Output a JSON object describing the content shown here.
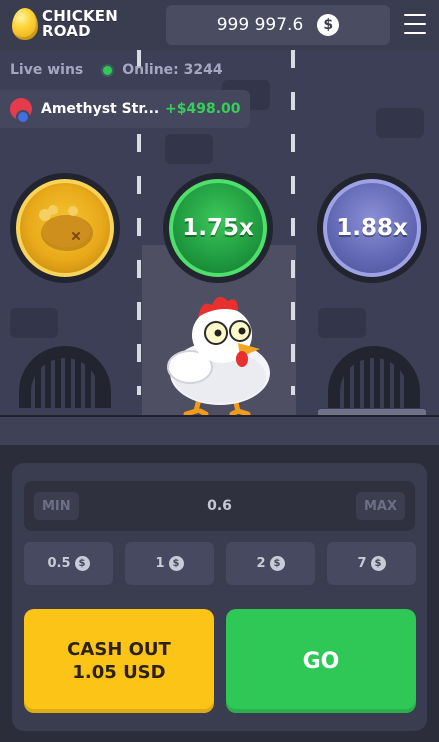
{
  "header": {
    "logo_line1": "CHICKEN",
    "logo_line2": "ROAD",
    "balance": "999 997.6",
    "currency_symbol": "$"
  },
  "live": {
    "label": "Live wins",
    "online": "Online: 3244"
  },
  "last_win": {
    "player": "Amethyst Str...",
    "amount": "+$498.00"
  },
  "lanes": {
    "multipliers": [
      "1.75x",
      "1.88x"
    ]
  },
  "controls": {
    "min_label": "MIN",
    "max_label": "MAX",
    "bet_value": "0.6",
    "quick_bets": [
      "0.5",
      "1",
      "2",
      "7"
    ],
    "cashout_line1": "CASH OUT",
    "cashout_line2": "1.05 USD",
    "go_label": "GO"
  },
  "colors": {
    "cashout": "#fcc417",
    "go": "#2fc857",
    "win_amount": "#34d058"
  }
}
